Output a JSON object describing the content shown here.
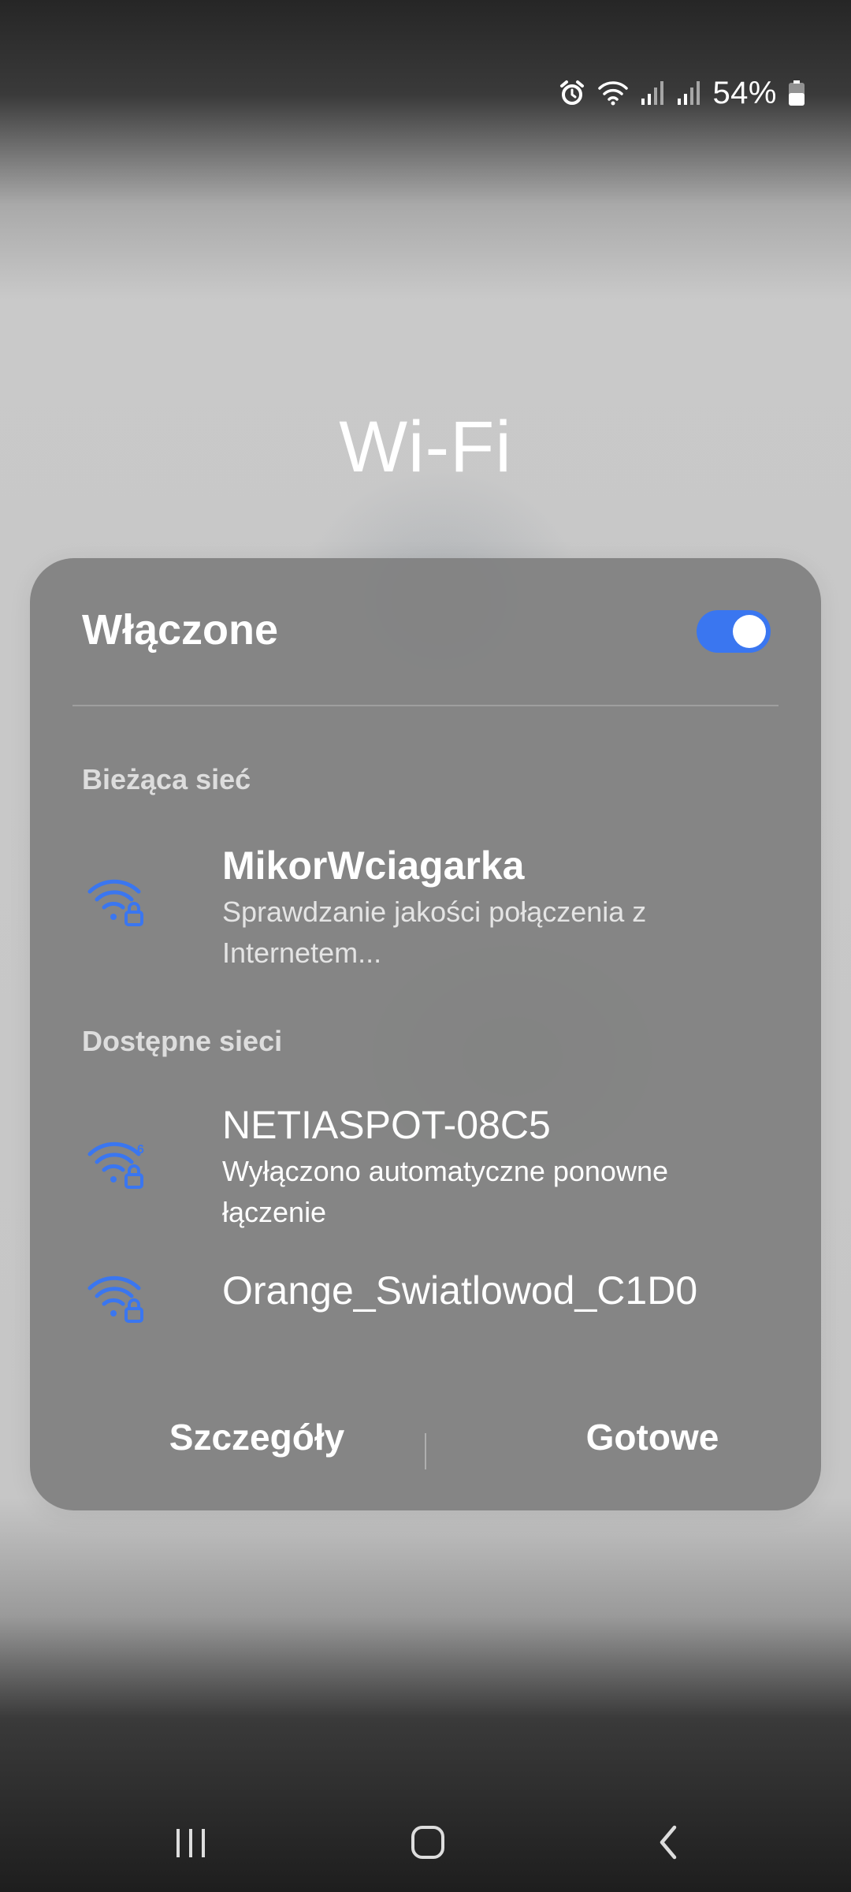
{
  "status_bar": {
    "battery_percent": "54%",
    "icons": [
      "alarm-icon",
      "wifi-icon",
      "signal-icon",
      "signal-icon",
      "battery-icon"
    ]
  },
  "title": "Wi-Fi",
  "panel": {
    "status_label": "Włączone",
    "toggle_on": true,
    "current_section": "Bieżąca sieć",
    "current_network": {
      "name": "MikorWciagarka",
      "status": "Sprawdzanie jakości połączenia z Internetem..."
    },
    "available_section": "Dostępne sieci",
    "available_networks": [
      {
        "name": "NETIASPOT-08C5",
        "status": "Wyłączono automatyczne ponowne łączenie",
        "icon": "wifi6-lock-icon"
      },
      {
        "name": "Orange_Swiatlowod_C1D0",
        "icon": "wifi-lock-icon"
      }
    ],
    "footer": {
      "details_label": "Szczegóły",
      "done_label": "Gotowe"
    }
  },
  "nav_bar": {
    "icons": [
      "recent-apps-icon",
      "home-icon",
      "back-icon"
    ]
  },
  "colors": {
    "accent": "#3a76f0",
    "panel": "#808080"
  }
}
